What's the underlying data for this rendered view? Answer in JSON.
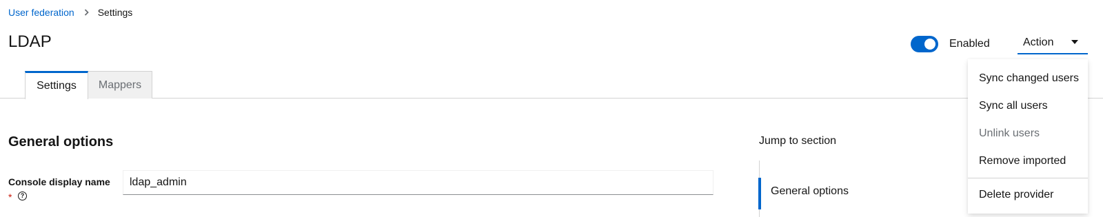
{
  "breadcrumb": {
    "parent": "User federation",
    "separator_icon": "chevron-right-icon",
    "current": "Settings"
  },
  "header": {
    "title": "LDAP",
    "toggle": {
      "label": "Enabled",
      "checked": true
    },
    "action_label": "Action"
  },
  "tabs": [
    {
      "label": "Settings",
      "active": true
    },
    {
      "label": "Mappers",
      "active": false
    }
  ],
  "action_menu": {
    "items": [
      {
        "label": "Sync changed users",
        "disabled": false
      },
      {
        "label": "Sync all users",
        "disabled": false
      },
      {
        "label": "Unlink users",
        "disabled": true
      },
      {
        "label": "Remove imported",
        "disabled": false
      }
    ],
    "danger_item": {
      "label": "Delete provider"
    }
  },
  "form": {
    "section_title": "General options",
    "fields": [
      {
        "label": "Console display name",
        "required_mark": "*",
        "help_icon": "question-circle-icon",
        "value": "ldap_admin"
      }
    ]
  },
  "jump_to": {
    "title": "Jump to section",
    "items": [
      "General options"
    ]
  },
  "colors": {
    "accent": "#0066cc",
    "required": "#c9190b",
    "muted": "#6a6e73"
  }
}
